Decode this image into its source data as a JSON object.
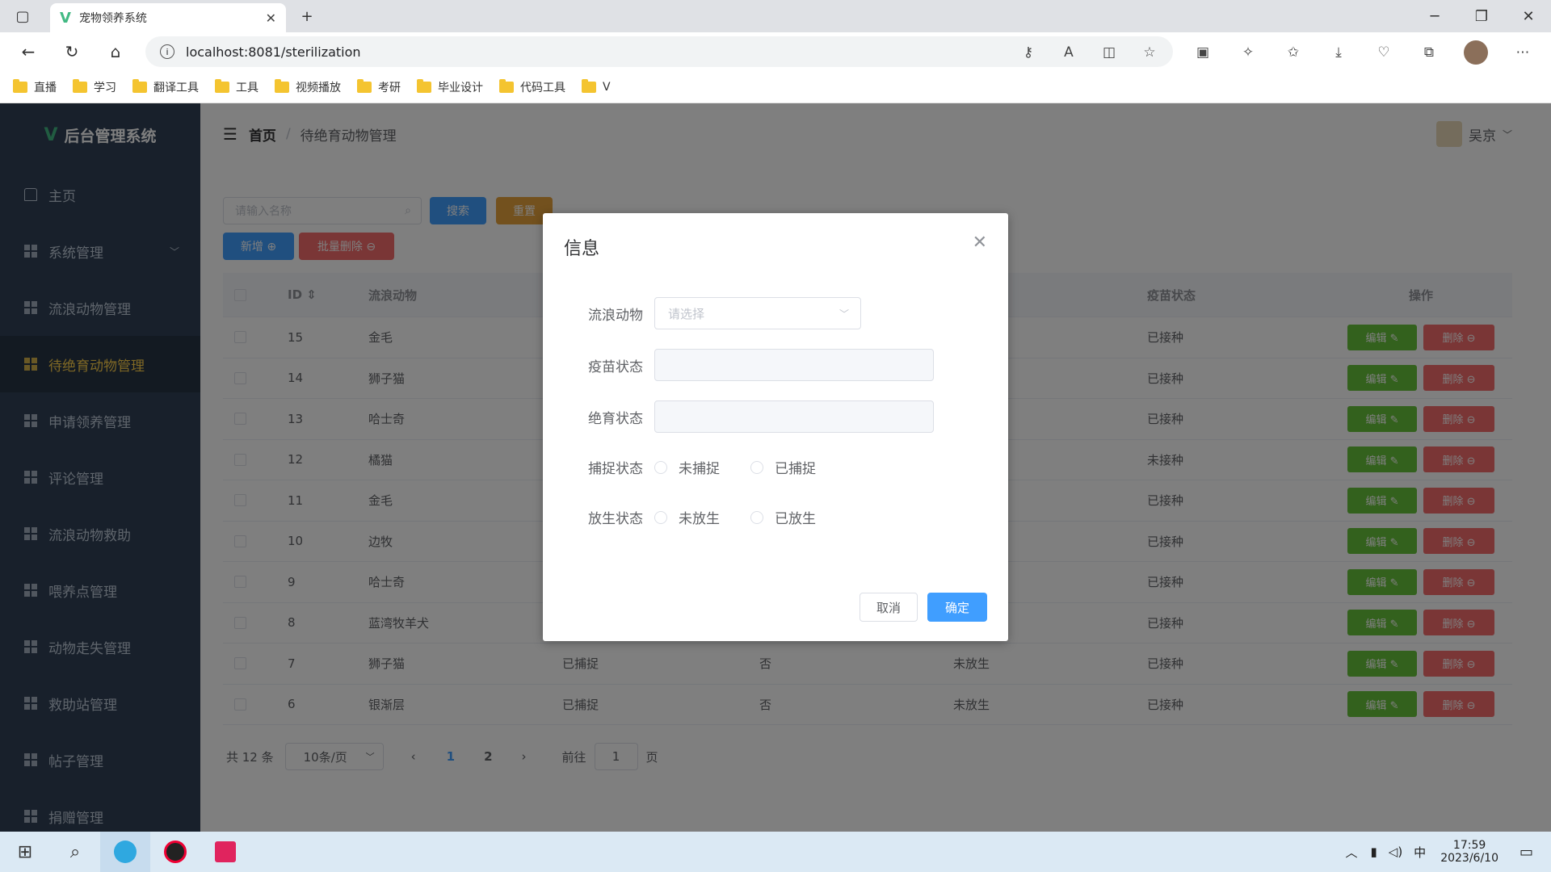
{
  "browser": {
    "tab_title": "宠物领养系统",
    "url": "localhost:8081/sterilization",
    "bookmarks": [
      "直播",
      "学习",
      "翻译工具",
      "工具",
      "视频播放",
      "考研",
      "毕业设计",
      "代码工具",
      "V"
    ]
  },
  "app": {
    "logo": "后台管理系统",
    "user": "吴京",
    "breadcrumb": {
      "home": "首页",
      "current": "待绝育动物管理"
    }
  },
  "sidebar": {
    "items": [
      {
        "label": "主页"
      },
      {
        "label": "系统管理"
      },
      {
        "label": "流浪动物管理"
      },
      {
        "label": "待绝育动物管理"
      },
      {
        "label": "申请领养管理"
      },
      {
        "label": "评论管理"
      },
      {
        "label": "流浪动物救助"
      },
      {
        "label": "喂养点管理"
      },
      {
        "label": "动物走失管理"
      },
      {
        "label": "救助站管理"
      },
      {
        "label": "帖子管理"
      },
      {
        "label": "捐赠管理"
      }
    ]
  },
  "toolbar": {
    "search_placeholder": "请输入名称",
    "search_label": "搜索",
    "reset_label": "重置",
    "add_label": "新增 ⊕",
    "batch_delete_label": "批量删除 ⊖"
  },
  "table": {
    "columns": {
      "id": "ID",
      "animal": "流浪动物",
      "vaccine": "疫苗状态",
      "ops": "操作"
    },
    "edit_label": "编辑 ✎",
    "delete_label": "删除 ⊖",
    "rows": [
      {
        "id": "15",
        "animal": "金毛",
        "vaccine": "已接种"
      },
      {
        "id": "14",
        "animal": "狮子猫",
        "vaccine": "已接种"
      },
      {
        "id": "13",
        "animal": "哈士奇",
        "vaccine": "已接种"
      },
      {
        "id": "12",
        "animal": "橘猫",
        "vaccine": "未接种"
      },
      {
        "id": "11",
        "animal": "金毛",
        "vaccine": "已接种"
      },
      {
        "id": "10",
        "animal": "边牧",
        "vaccine": "已接种"
      },
      {
        "id": "9",
        "animal": "哈士奇",
        "vaccine": "已接种"
      },
      {
        "id": "8",
        "animal": "蓝湾牧羊犬",
        "vaccine": "已接种"
      },
      {
        "id": "7",
        "animal": "狮子猫",
        "capture": "已捕捉",
        "sterilized": "否",
        "release": "未放生",
        "vaccine": "已接种"
      },
      {
        "id": "6",
        "animal": "银渐层",
        "capture": "已捕捉",
        "sterilized": "否",
        "release": "未放生",
        "vaccine": "已接种"
      }
    ]
  },
  "pager": {
    "total": "共 12 条",
    "size": "10条/页",
    "page1": "1",
    "page2": "2",
    "goto": "前往",
    "goto_value": "1",
    "page_unit": "页"
  },
  "dialog": {
    "title": "信息",
    "animal_label": "流浪动物",
    "animal_placeholder": "请选择",
    "vaccine_label": "疫苗状态",
    "sterilize_label": "绝育状态",
    "capture_label": "捕捉状态",
    "capture_opt1": "未捕捉",
    "capture_opt2": "已捕捉",
    "release_label": "放生状态",
    "release_opt1": "未放生",
    "release_opt2": "已放生",
    "cancel": "取消",
    "confirm": "确定"
  },
  "taskbar": {
    "ime": "中",
    "time": "17:59",
    "date": "2023/6/10"
  },
  "colors": {
    "primary": "#409eff",
    "success": "#67c23a",
    "danger": "#f56c6c",
    "warning": "#e6a23c",
    "sidebar": "#304156",
    "active_menu": "#ffd04b"
  }
}
